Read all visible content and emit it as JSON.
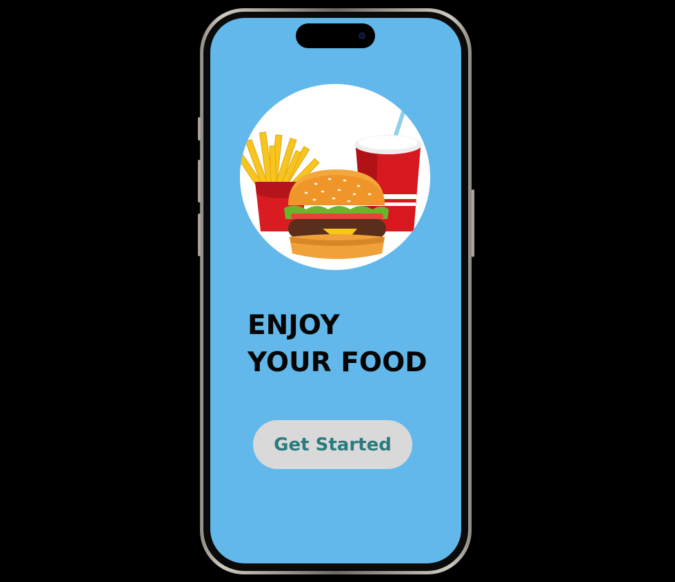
{
  "screen": {
    "headline_line1": "ENJOY",
    "headline_line2": "YOUR FOOD",
    "button_label": "Get Started"
  },
  "illustration": {
    "items": [
      "french-fries",
      "burger",
      "soda-cup"
    ]
  },
  "colors": {
    "page_background": "#000000",
    "screen_background": "#62b8ea",
    "button_background": "#d9d9d9",
    "button_text": "#2b7a7e",
    "headline_text": "#050505"
  }
}
